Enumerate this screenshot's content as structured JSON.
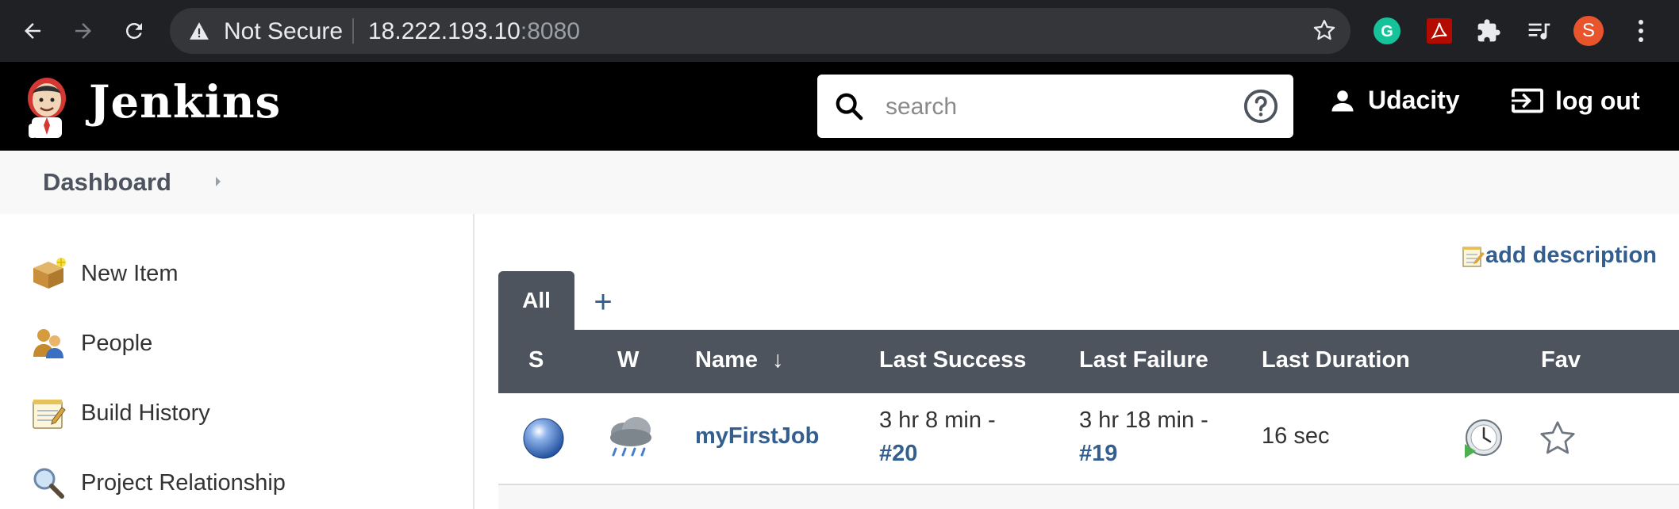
{
  "browser": {
    "security_label": "Not Secure",
    "url_host": "18.222.193.10",
    "url_port": ":8080",
    "profile_initial": "S"
  },
  "header": {
    "brand": "Jenkins",
    "search_placeholder": "search",
    "user": "Udacity",
    "logout": "log out"
  },
  "breadcrumb": {
    "dashboard": "Dashboard"
  },
  "sidebar": {
    "items": [
      {
        "label": "New Item",
        "icon": "new-item-box-icon"
      },
      {
        "label": "People",
        "icon": "people-icon"
      },
      {
        "label": "Build History",
        "icon": "notepad-icon"
      },
      {
        "label": "Project Relationship",
        "icon": "magnifier-icon"
      }
    ]
  },
  "main": {
    "add_description": "add description",
    "tabs": [
      {
        "label": "All"
      }
    ],
    "add_tab": "+",
    "columns": {
      "s": "S",
      "w": "W",
      "name": "Name",
      "name_sort": "↓",
      "last_success": "Last Success",
      "last_failure": "Last Failure",
      "last_duration": "Last Duration",
      "fav": "Fav"
    },
    "rows": [
      {
        "name": "myFirstJob",
        "last_success_time": "3 hr 8 min -",
        "last_success_build": "#20",
        "last_failure_time": "3 hr 18 min -",
        "last_failure_build": "#19",
        "last_duration": "16 sec"
      }
    ]
  },
  "colors": {
    "header_bg": "#000000",
    "table_header_bg": "#4d545d",
    "link": "#335e8e",
    "status_ball": "#3a6fc4"
  }
}
